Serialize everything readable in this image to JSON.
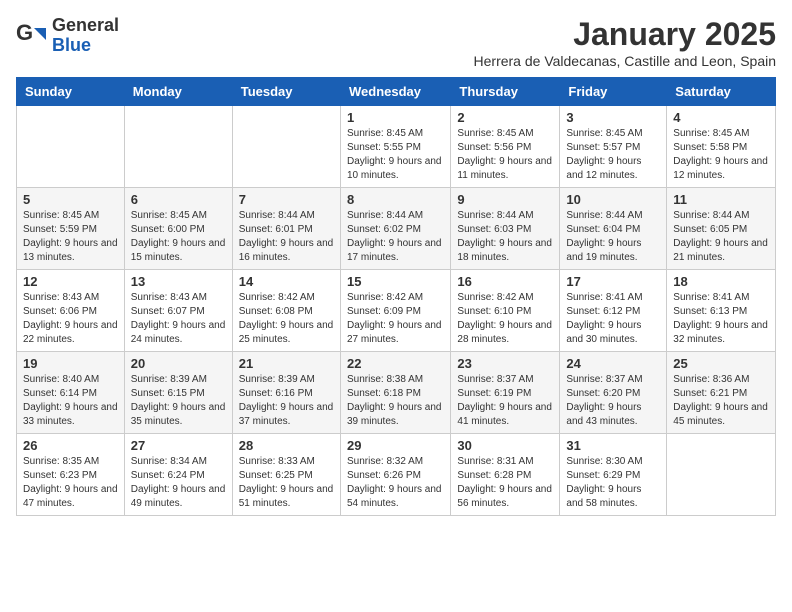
{
  "header": {
    "logo_general": "General",
    "logo_blue": "Blue",
    "month_title": "January 2025",
    "subtitle": "Herrera de Valdecanas, Castille and Leon, Spain"
  },
  "days_of_week": [
    "Sunday",
    "Monday",
    "Tuesday",
    "Wednesday",
    "Thursday",
    "Friday",
    "Saturday"
  ],
  "weeks": [
    [
      {
        "day": "",
        "info": ""
      },
      {
        "day": "",
        "info": ""
      },
      {
        "day": "",
        "info": ""
      },
      {
        "day": "1",
        "info": "Sunrise: 8:45 AM\nSunset: 5:55 PM\nDaylight: 9 hours and 10 minutes."
      },
      {
        "day": "2",
        "info": "Sunrise: 8:45 AM\nSunset: 5:56 PM\nDaylight: 9 hours and 11 minutes."
      },
      {
        "day": "3",
        "info": "Sunrise: 8:45 AM\nSunset: 5:57 PM\nDaylight: 9 hours and 12 minutes."
      },
      {
        "day": "4",
        "info": "Sunrise: 8:45 AM\nSunset: 5:58 PM\nDaylight: 9 hours and 12 minutes."
      }
    ],
    [
      {
        "day": "5",
        "info": "Sunrise: 8:45 AM\nSunset: 5:59 PM\nDaylight: 9 hours and 13 minutes."
      },
      {
        "day": "6",
        "info": "Sunrise: 8:45 AM\nSunset: 6:00 PM\nDaylight: 9 hours and 15 minutes."
      },
      {
        "day": "7",
        "info": "Sunrise: 8:44 AM\nSunset: 6:01 PM\nDaylight: 9 hours and 16 minutes."
      },
      {
        "day": "8",
        "info": "Sunrise: 8:44 AM\nSunset: 6:02 PM\nDaylight: 9 hours and 17 minutes."
      },
      {
        "day": "9",
        "info": "Sunrise: 8:44 AM\nSunset: 6:03 PM\nDaylight: 9 hours and 18 minutes."
      },
      {
        "day": "10",
        "info": "Sunrise: 8:44 AM\nSunset: 6:04 PM\nDaylight: 9 hours and 19 minutes."
      },
      {
        "day": "11",
        "info": "Sunrise: 8:44 AM\nSunset: 6:05 PM\nDaylight: 9 hours and 21 minutes."
      }
    ],
    [
      {
        "day": "12",
        "info": "Sunrise: 8:43 AM\nSunset: 6:06 PM\nDaylight: 9 hours and 22 minutes."
      },
      {
        "day": "13",
        "info": "Sunrise: 8:43 AM\nSunset: 6:07 PM\nDaylight: 9 hours and 24 minutes."
      },
      {
        "day": "14",
        "info": "Sunrise: 8:42 AM\nSunset: 6:08 PM\nDaylight: 9 hours and 25 minutes."
      },
      {
        "day": "15",
        "info": "Sunrise: 8:42 AM\nSunset: 6:09 PM\nDaylight: 9 hours and 27 minutes."
      },
      {
        "day": "16",
        "info": "Sunrise: 8:42 AM\nSunset: 6:10 PM\nDaylight: 9 hours and 28 minutes."
      },
      {
        "day": "17",
        "info": "Sunrise: 8:41 AM\nSunset: 6:12 PM\nDaylight: 9 hours and 30 minutes."
      },
      {
        "day": "18",
        "info": "Sunrise: 8:41 AM\nSunset: 6:13 PM\nDaylight: 9 hours and 32 minutes."
      }
    ],
    [
      {
        "day": "19",
        "info": "Sunrise: 8:40 AM\nSunset: 6:14 PM\nDaylight: 9 hours and 33 minutes."
      },
      {
        "day": "20",
        "info": "Sunrise: 8:39 AM\nSunset: 6:15 PM\nDaylight: 9 hours and 35 minutes."
      },
      {
        "day": "21",
        "info": "Sunrise: 8:39 AM\nSunset: 6:16 PM\nDaylight: 9 hours and 37 minutes."
      },
      {
        "day": "22",
        "info": "Sunrise: 8:38 AM\nSunset: 6:18 PM\nDaylight: 9 hours and 39 minutes."
      },
      {
        "day": "23",
        "info": "Sunrise: 8:37 AM\nSunset: 6:19 PM\nDaylight: 9 hours and 41 minutes."
      },
      {
        "day": "24",
        "info": "Sunrise: 8:37 AM\nSunset: 6:20 PM\nDaylight: 9 hours and 43 minutes."
      },
      {
        "day": "25",
        "info": "Sunrise: 8:36 AM\nSunset: 6:21 PM\nDaylight: 9 hours and 45 minutes."
      }
    ],
    [
      {
        "day": "26",
        "info": "Sunrise: 8:35 AM\nSunset: 6:23 PM\nDaylight: 9 hours and 47 minutes."
      },
      {
        "day": "27",
        "info": "Sunrise: 8:34 AM\nSunset: 6:24 PM\nDaylight: 9 hours and 49 minutes."
      },
      {
        "day": "28",
        "info": "Sunrise: 8:33 AM\nSunset: 6:25 PM\nDaylight: 9 hours and 51 minutes."
      },
      {
        "day": "29",
        "info": "Sunrise: 8:32 AM\nSunset: 6:26 PM\nDaylight: 9 hours and 54 minutes."
      },
      {
        "day": "30",
        "info": "Sunrise: 8:31 AM\nSunset: 6:28 PM\nDaylight: 9 hours and 56 minutes."
      },
      {
        "day": "31",
        "info": "Sunrise: 8:30 AM\nSunset: 6:29 PM\nDaylight: 9 hours and 58 minutes."
      },
      {
        "day": "",
        "info": ""
      }
    ]
  ]
}
